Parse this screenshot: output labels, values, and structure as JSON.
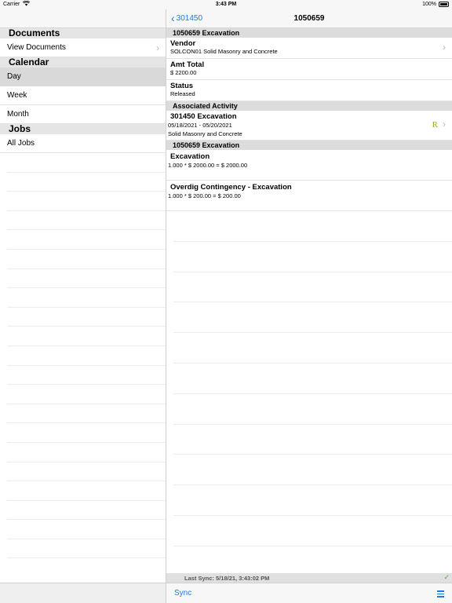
{
  "status_bar": {
    "carrier": "Carrier",
    "time": "3:43 PM",
    "battery": "100%"
  },
  "left": {
    "sections": {
      "documents": "Documents",
      "calendar": "Calendar",
      "jobs": "Jobs"
    },
    "items": {
      "view_documents": "View Documents",
      "day": "Day",
      "week": "Week",
      "month": "Month",
      "all_jobs": "All Jobs"
    }
  },
  "nav": {
    "back_label": "301450",
    "title": "1050659"
  },
  "detail": {
    "header_section": "1050659 Excavation",
    "vendor_label": "Vendor",
    "vendor_value": "SOLCON01 Solid Masonry and Concrete",
    "amt_label": "Amt Total",
    "amt_value": "$ 2200.00",
    "status_label": "Status",
    "status_value": "Released",
    "assoc_section": "Associated Activity",
    "activity": {
      "title": "301450 Excavation",
      "dates": "05/18/2021 - 05/20/2021",
      "vendor": "Solid Masonry and Concrete",
      "badge": "R"
    },
    "items_section": "1050659 Excavation",
    "line_items": [
      {
        "label": "Excavation",
        "calc": "1.000 * $ 2000.00 = $ 2000.00"
      },
      {
        "label": "Overdig Contingency - Excavation",
        "calc": "1.000 * $ 200.00 = $ 200.00"
      }
    ]
  },
  "sync": {
    "last_sync": "Last Sync: 5/18/21, 3:43:02 PM",
    "sync_button": "Sync"
  },
  "colors": {
    "accent": "#1a7ae0",
    "badge": "#8bb02a",
    "sync_check": "#4caf50"
  }
}
